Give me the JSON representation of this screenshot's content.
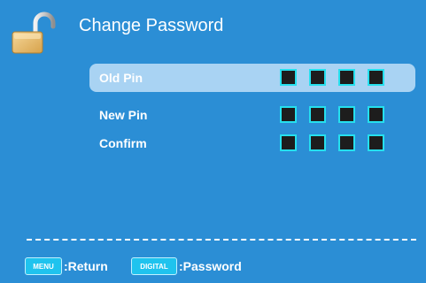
{
  "header": {
    "title": "Change Password",
    "icon": "unlocked-padlock-icon"
  },
  "pin_rows": [
    {
      "label": "Old Pin",
      "selected": true,
      "digits_entered": 4,
      "mask": [
        "■",
        "■",
        "■",
        "■"
      ]
    },
    {
      "label": "New Pin",
      "selected": false,
      "digits_entered": 4,
      "mask": [
        "■",
        "■",
        "■",
        "■"
      ]
    },
    {
      "label": "Confirm",
      "selected": false,
      "digits_entered": 4,
      "mask": [
        "■",
        "■",
        "■",
        "■"
      ]
    }
  ],
  "footer": {
    "menu_key": "MENU",
    "menu_action": ":Return",
    "digital_key": "DIGITAL",
    "digital_action": ":Password"
  },
  "colors": {
    "background": "#2b8ed5",
    "selected_row": "#a9d3f3",
    "pin_fill": "#1d1d1d",
    "pin_border": "#25e0ee",
    "key_button": "#1fc3ee"
  }
}
